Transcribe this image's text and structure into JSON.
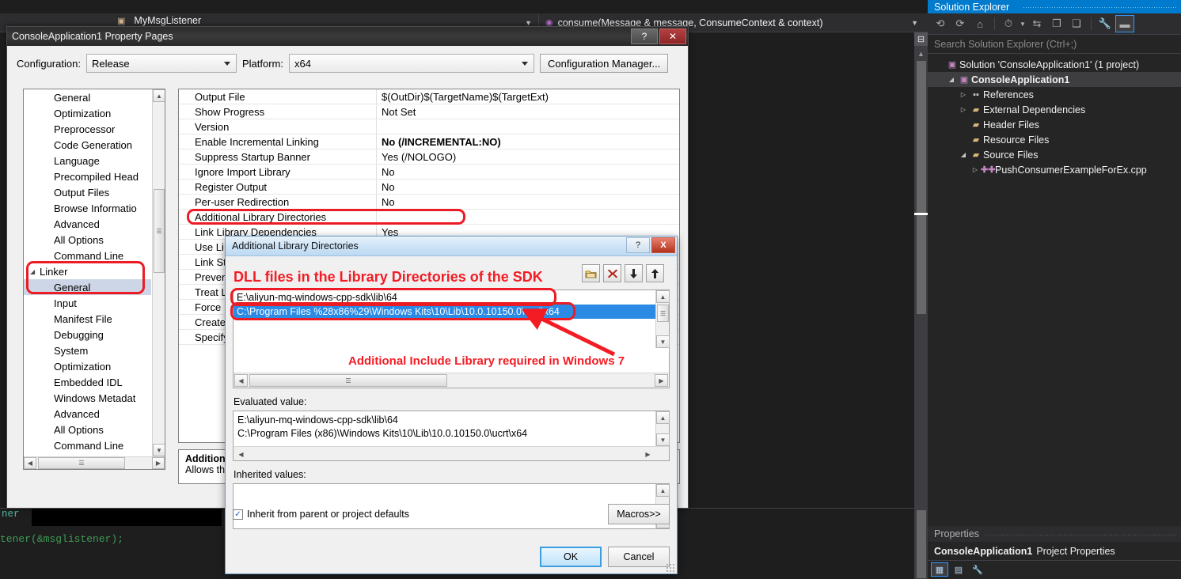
{
  "editor": {
    "nav_left_item": "MyMsgListener",
    "nav_right_item": "consume(Message & message, ConsumeContext & context)",
    "bottom_tab_label": "ner",
    "code_line": "tener(&msglistener);"
  },
  "solution_explorer": {
    "title": "Solution Explorer",
    "search_placeholder": "Search Solution Explorer (Ctrl+;)",
    "toolbar": [
      {
        "name": "back-icon",
        "glyph": "←"
      },
      {
        "name": "forward-icon",
        "glyph": "→"
      },
      {
        "name": "home-icon",
        "glyph": "⌂"
      },
      {
        "name": "pending-changes-icon",
        "glyph": "◴"
      },
      {
        "name": "sync-icon",
        "glyph": "⇆"
      },
      {
        "name": "collapse-all-icon",
        "glyph": "❐"
      },
      {
        "name": "show-all-files-icon",
        "glyph": "❑"
      },
      {
        "name": "properties-wrench-icon",
        "glyph": "⚒"
      },
      {
        "name": "preview-icon",
        "glyph": "➖"
      }
    ],
    "tree": [
      {
        "label": "Solution 'ConsoleApplication1' (1 project)",
        "icon": "solution-icon",
        "indent": 0,
        "twisty": "",
        "bold": false
      },
      {
        "label": "ConsoleApplication1",
        "icon": "project-icon",
        "indent": 1,
        "twisty": "◢",
        "bold": true
      },
      {
        "label": "References",
        "icon": "references-icon",
        "indent": 2,
        "twisty": "▷",
        "bold": false
      },
      {
        "label": "External Dependencies",
        "icon": "folder-icon",
        "indent": 2,
        "twisty": "▷",
        "bold": false
      },
      {
        "label": "Header Files",
        "icon": "folder-icon",
        "indent": 2,
        "twisty": "",
        "bold": false
      },
      {
        "label": "Resource Files",
        "icon": "folder-icon",
        "indent": 2,
        "twisty": "",
        "bold": false
      },
      {
        "label": "Source Files",
        "icon": "folder-open-icon",
        "indent": 2,
        "twisty": "◢",
        "bold": false
      },
      {
        "label": "PushConsumerExampleForEx.cpp",
        "icon": "cpp-file-icon",
        "indent": 3,
        "twisty": "▷",
        "bold": false
      }
    ]
  },
  "properties_panel": {
    "title": "Properties",
    "subject_bold": "ConsoleApplication1",
    "subject_rest": "Project Properties"
  },
  "property_pages": {
    "window_title": "ConsoleApplication1 Property Pages",
    "help_button": "?",
    "close_button": "✕",
    "configuration_label": "Configuration:",
    "configuration_value": "Release",
    "platform_label": "Platform:",
    "platform_value": "x64",
    "configuration_manager_button": "Configuration Manager...",
    "tree": [
      {
        "label": "General",
        "indent": 1,
        "twisty": "",
        "selected": false
      },
      {
        "label": "Optimization",
        "indent": 1,
        "twisty": "",
        "selected": false
      },
      {
        "label": "Preprocessor",
        "indent": 1,
        "twisty": "",
        "selected": false
      },
      {
        "label": "Code Generation",
        "indent": 1,
        "twisty": "",
        "selected": false
      },
      {
        "label": "Language",
        "indent": 1,
        "twisty": "",
        "selected": false
      },
      {
        "label": "Precompiled Head",
        "indent": 1,
        "twisty": "",
        "selected": false
      },
      {
        "label": "Output Files",
        "indent": 1,
        "twisty": "",
        "selected": false
      },
      {
        "label": "Browse Informatio",
        "indent": 1,
        "twisty": "",
        "selected": false
      },
      {
        "label": "Advanced",
        "indent": 1,
        "twisty": "",
        "selected": false
      },
      {
        "label": "All Options",
        "indent": 1,
        "twisty": "",
        "selected": false
      },
      {
        "label": "Command Line",
        "indent": 1,
        "twisty": "",
        "selected": false
      },
      {
        "label": "Linker",
        "indent": 0,
        "twisty": "◢",
        "selected": false
      },
      {
        "label": "General",
        "indent": 1,
        "twisty": "",
        "selected": true
      },
      {
        "label": "Input",
        "indent": 1,
        "twisty": "",
        "selected": false
      },
      {
        "label": "Manifest File",
        "indent": 1,
        "twisty": "",
        "selected": false
      },
      {
        "label": "Debugging",
        "indent": 1,
        "twisty": "",
        "selected": false
      },
      {
        "label": "System",
        "indent": 1,
        "twisty": "",
        "selected": false
      },
      {
        "label": "Optimization",
        "indent": 1,
        "twisty": "",
        "selected": false
      },
      {
        "label": "Embedded IDL",
        "indent": 1,
        "twisty": "",
        "selected": false
      },
      {
        "label": "Windows Metadat",
        "indent": 1,
        "twisty": "",
        "selected": false
      },
      {
        "label": "Advanced",
        "indent": 1,
        "twisty": "",
        "selected": false
      },
      {
        "label": "All Options",
        "indent": 1,
        "twisty": "",
        "selected": false
      },
      {
        "label": "Command Line",
        "indent": 1,
        "twisty": "",
        "selected": false
      }
    ],
    "grid": [
      {
        "name": "Output File",
        "value": "$(OutDir)$(TargetName)$(TargetExt)",
        "bold": false
      },
      {
        "name": "Show Progress",
        "value": "Not Set",
        "bold": false
      },
      {
        "name": "Version",
        "value": "",
        "bold": false
      },
      {
        "name": "Enable Incremental Linking",
        "value": "No (/INCREMENTAL:NO)",
        "bold": true
      },
      {
        "name": "Suppress Startup Banner",
        "value": "Yes (/NOLOGO)",
        "bold": false
      },
      {
        "name": "Ignore Import Library",
        "value": "No",
        "bold": false
      },
      {
        "name": "Register Output",
        "value": "No",
        "bold": false
      },
      {
        "name": "Per-user Redirection",
        "value": "No",
        "bold": false
      },
      {
        "name": "Additional Library Directories",
        "value": "",
        "bold": false
      },
      {
        "name": "Link Library Dependencies",
        "value": "Yes",
        "bold": false
      },
      {
        "name": "Use Li",
        "value": "",
        "bold": false
      },
      {
        "name": "Link St",
        "value": "",
        "bold": false
      },
      {
        "name": "Preven",
        "value": "",
        "bold": false
      },
      {
        "name": "Treat L",
        "value": "",
        "bold": false
      },
      {
        "name": "Force",
        "value": "",
        "bold": false
      },
      {
        "name": "Create",
        "value": "",
        "bold": false
      },
      {
        "name": "Specify",
        "value": "",
        "bold": false
      }
    ],
    "description_title": "Additiona",
    "description_text": "Allows the"
  },
  "ald_dialog": {
    "title": "Additional Library Directories",
    "help_button": "?",
    "close_button": "X",
    "toolbar": [
      {
        "name": "new-folder-icon",
        "glyph": "📁"
      },
      {
        "name": "delete-icon",
        "glyph": "✕"
      },
      {
        "name": "move-down-icon",
        "glyph": "↓"
      },
      {
        "name": "move-up-icon",
        "glyph": "↑"
      }
    ],
    "entries": [
      {
        "text": "E:\\aliyun-mq-windows-cpp-sdk\\lib\\64",
        "selected": false
      },
      {
        "text": "C:\\Program Files %28x86%29\\Windows Kits\\10\\Lib\\10.0.10150.0\\ucrt\\x64",
        "selected": true
      }
    ],
    "evaluated_label": "Evaluated value:",
    "evaluated_lines": [
      "E:\\aliyun-mq-windows-cpp-sdk\\lib\\64",
      "C:\\Program Files (x86)\\Windows Kits\\10\\Lib\\10.0.10150.0\\ucrt\\x64"
    ],
    "inherited_label": "Inherited values:",
    "inherited_lines": [],
    "inherit_checkbox_label": "Inherit from parent or project defaults",
    "inherit_checked": true,
    "macros_button": "Macros>>",
    "ok_button": "OK",
    "cancel_button": "Cancel"
  },
  "annotations": {
    "color": "#f41c24",
    "note_sdk": "DLL  files in the Library Directories of the SDK",
    "note_win7": "Additional Include Library required in Windows 7"
  }
}
